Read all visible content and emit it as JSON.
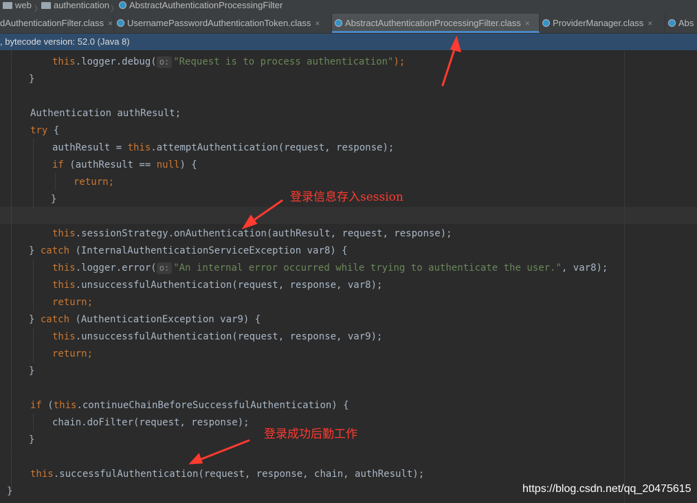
{
  "breadcrumb": {
    "items": [
      "web",
      "authentication",
      "AbstractAuthenticationProcessingFilter"
    ]
  },
  "tabs": [
    {
      "label": "dAuthenticationFilter.class",
      "close": "×"
    },
    {
      "label": "UsernamePasswordAuthenticationToken.class",
      "close": "×"
    },
    {
      "label": "AbstractAuthenticationProcessingFilter.class",
      "close": "×"
    },
    {
      "label": "ProviderManager.class",
      "close": "×"
    },
    {
      "label": "Abs",
      "close": ""
    }
  ],
  "info_bar": {
    "text": ", bytecode version: 52.0 (Java 8)"
  },
  "code": {
    "hint": "o:",
    "lines": {
      "l1_pre": "this",
      "l1_a": ".logger.debug(",
      "l1_str": "\"Request is to process authentication\"",
      "l1_end": ");",
      "l2": "}",
      "l3": "Authentication authResult;",
      "l4_kw": "try",
      "l4": " {",
      "l5_a": "authResult = ",
      "l5_kw": "this",
      "l5_b": ".attemptAuthentication(request, response);",
      "l6_kw": "if",
      "l6_a": " (authResult == ",
      "l6_null": "null",
      "l6_b": ") {",
      "l7": "return;",
      "l8": "}",
      "l9_kw": "this",
      "l9_a": ".sessionStrategy.onAuthentication(authResult, request, response);",
      "l10_a": "} ",
      "l10_kw": "catch",
      "l10_b": " (InternalAuthenticationServiceException var8) {",
      "l11_kw": "this",
      "l11_a": ".logger.error(",
      "l11_str": "\"An internal error occurred while trying to authenticate the user.\"",
      "l11_b": ", var8);",
      "l12_kw": "this",
      "l12_a": ".unsuccessfulAuthentication(request, response, var8);",
      "l13": "return;",
      "l14_a": "} ",
      "l14_kw": "catch",
      "l14_b": " (AuthenticationException var9) {",
      "l15_kw": "this",
      "l15_a": ".unsuccessfulAuthentication(request, response, var9);",
      "l16": "return;",
      "l17": "}",
      "l18_kw": "if",
      "l18_a": " (",
      "l18_kw2": "this",
      "l18_b": ".continueChainBeforeSuccessfulAuthentication) {",
      "l19": "chain.doFilter(request, response);",
      "l20": "}",
      "l21_kw": "this",
      "l21_a": ".successfulAuthentication(request, response, chain, authResult);",
      "l22": "}"
    }
  },
  "annotations": {
    "session_note": "登录信息存入session",
    "success_note": "登录成功后勤工作"
  },
  "watermark": "https://blog.csdn.net/qq_20475615",
  "colors": {
    "background": "#2b2b2b",
    "keyword": "#cc7832",
    "string": "#6a8759",
    "plain": "#a9b7c6",
    "annotation": "#ff3b30",
    "info_bar": "#2f4c6c"
  }
}
